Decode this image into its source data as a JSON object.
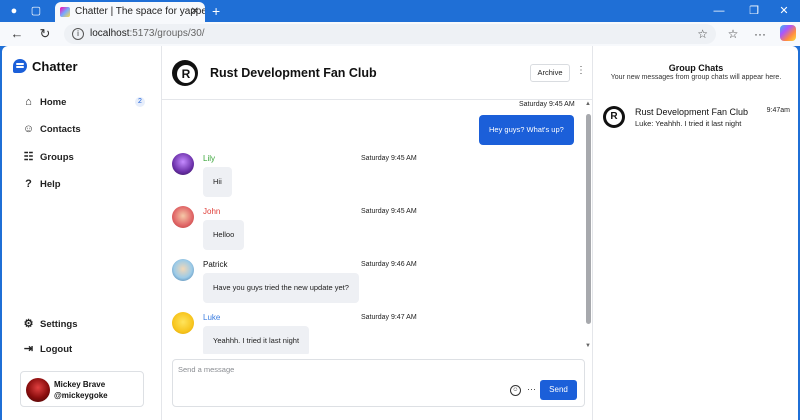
{
  "browser": {
    "tab_title": "Chatter | The space for yappers",
    "url_host": "localhost",
    "url_path": ":5173/groups/30/",
    "colors": {
      "titlebar": "#1f6fd6"
    }
  },
  "app": {
    "brand": "Chatter",
    "nav": {
      "home": {
        "label": "Home",
        "badge": "2",
        "icon": "home-icon"
      },
      "contacts": {
        "label": "Contacts",
        "icon": "contacts-icon"
      },
      "groups": {
        "label": "Groups",
        "icon": "groups-icon"
      },
      "help": {
        "label": "Help",
        "icon": "help-icon"
      },
      "settings": {
        "label": "Settings",
        "icon": "gear-icon"
      },
      "logout": {
        "label": "Logout",
        "icon": "logout-icon"
      }
    },
    "user": {
      "name": "Mickey Brave",
      "handle": "@mickeygoke"
    },
    "accent": "#1b5fd9"
  },
  "chat": {
    "title": "Rust Development Fan Club",
    "archive_label": "Archive",
    "messages": [
      {
        "sender": "",
        "time": "Saturday 9:45 AM",
        "text": "Hey guys? What's up?",
        "mine": true
      },
      {
        "sender": "Lily",
        "sender_color": "#3aa63a",
        "time": "Saturday 9:45 AM",
        "text": "Hii"
      },
      {
        "sender": "John",
        "sender_color": "#e0403a",
        "time": "Saturday 9:45 AM",
        "text": "Helloo"
      },
      {
        "sender": "Patrick",
        "sender_color": "#111111",
        "time": "Saturday 9:46 AM",
        "text": "Have you guys tried the new update yet?"
      },
      {
        "sender": "Luke",
        "sender_color": "#3b7de0",
        "time": "Saturday 9:47 AM",
        "text": "Yeahhh. I tried it last night"
      }
    ],
    "composer": {
      "placeholder": "Send a message",
      "send_label": "Send"
    }
  },
  "group_chats": {
    "title": "Group Chats",
    "subtitle": "Your new messages from group chats will appear here.",
    "items": [
      {
        "name": "Rust Development Fan Club",
        "time": "9:47am",
        "last_sender": "Luke:",
        "last_text": " Yeahhh. I tried it last night"
      }
    ]
  }
}
